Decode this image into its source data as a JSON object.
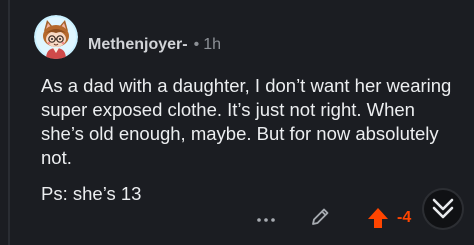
{
  "comment": {
    "username": "Methenjoyer-",
    "separator": "•",
    "age": "1h",
    "body": "As a dad with a daughter, I don’t want her wearing super exposed clothe. It’s just not right. When she’s old enough, maybe. But for now absolutely not.",
    "ps": "Ps: she’s 13",
    "score": "-4",
    "vote_state": "upvoted"
  },
  "icons": {
    "avatar": "snoo-avatar-cat-ears",
    "more": "more-horizontal-icon",
    "edit": "pencil-icon",
    "upvote": "upvote-arrow-icon",
    "collapse": "chevrons-down-icon"
  },
  "colors": {
    "background": "#1b1d22",
    "text": "#eceef0",
    "meta": "#8c9096",
    "upvote": "#ff4500",
    "avatar_ring": "#c9f0ff"
  }
}
